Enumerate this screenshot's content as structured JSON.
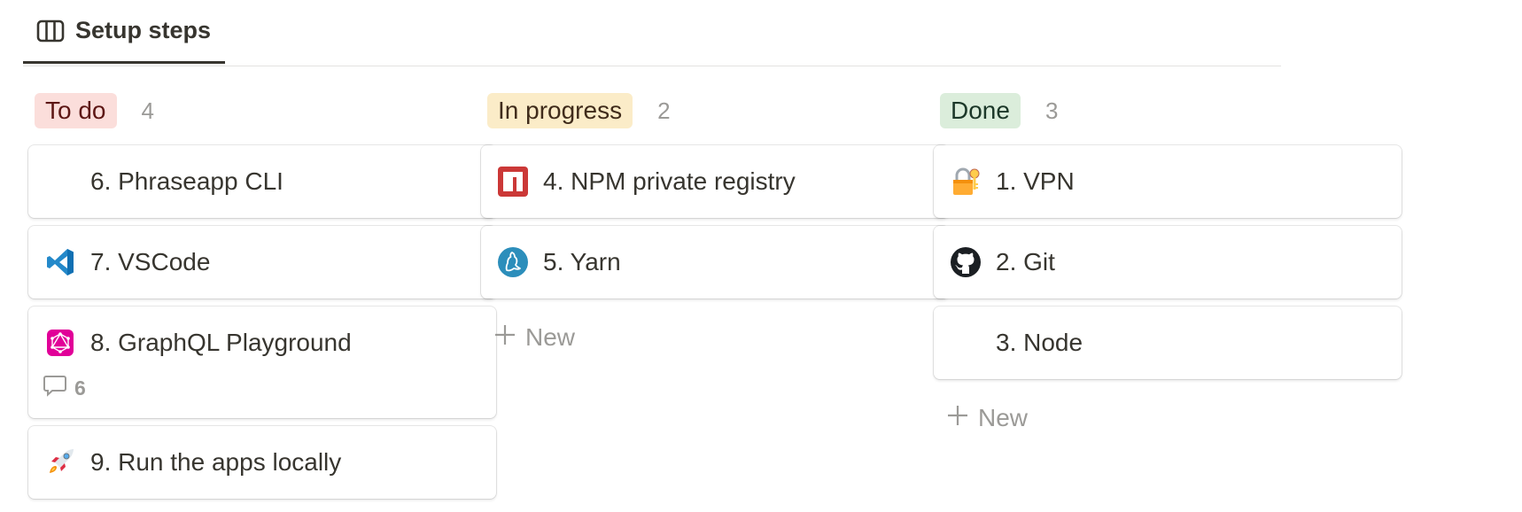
{
  "tab": {
    "label": "Setup steps",
    "icon": "board-icon"
  },
  "columns": [
    {
      "status": "To do",
      "count": "4",
      "pill_bg": "#fbdedb",
      "pill_fg": "#5d1715",
      "cards": [
        {
          "title": "6. Phraseapp CLI",
          "icon": ""
        },
        {
          "title": "7. VSCode",
          "icon": "vscode-icon"
        },
        {
          "title": "8. GraphQL Playground",
          "icon": "graphql-icon",
          "comments": "6"
        },
        {
          "title": "9. Run the apps locally",
          "icon": "rocket-icon"
        }
      ]
    },
    {
      "status": "In progress",
      "count": "2",
      "pill_bg": "#fbecc8",
      "pill_fg": "#402c1b",
      "cards": [
        {
          "title": "4. NPM private registry",
          "icon": "npm-icon"
        },
        {
          "title": "5. Yarn",
          "icon": "yarn-icon"
        }
      ],
      "new_label": "New"
    },
    {
      "status": "Done",
      "count": "3",
      "pill_bg": "#dbeddb",
      "pill_fg": "#1c3829",
      "cards": [
        {
          "title": "1. VPN",
          "icon": "lock-key-icon"
        },
        {
          "title": "2. Git",
          "icon": "github-icon"
        },
        {
          "title": "3. Node",
          "icon": ""
        }
      ],
      "new_label": "New"
    }
  ]
}
